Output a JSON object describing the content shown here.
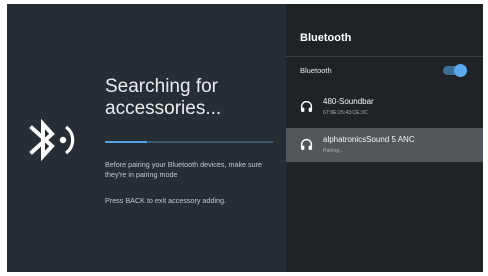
{
  "main": {
    "heading_line1": "Searching for",
    "heading_line2": "accessories...",
    "progress": 0.25,
    "hint_pairing": "Before pairing your Bluetooth devices, make sure they're in pairing mode",
    "hint_back": "Press BACK to exit accessory adding.",
    "icon": "bluetooth-searching-icon"
  },
  "panel": {
    "title": "Bluetooth",
    "toggle_label": "Bluetooth",
    "toggle_on": true,
    "devices": [
      {
        "name": "480-Soundbar",
        "detail": "67:9E:25:43:CE:3C",
        "icon": "headphones-icon"
      },
      {
        "name": "alphatronicsSound 5 ANC",
        "detail": "Pairing...",
        "icon": "headphones-icon",
        "selected": true
      }
    ]
  },
  "colors": {
    "accent": "#4fa3e6",
    "left_background": "#262e34",
    "panel_background": "#1f2326",
    "selected_row": "#53575b"
  }
}
